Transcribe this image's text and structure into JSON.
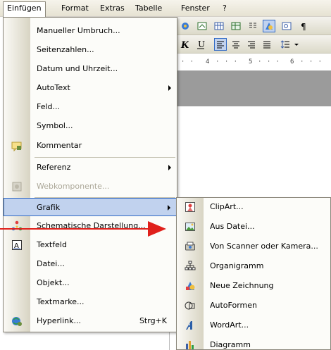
{
  "menubar": {
    "items": [
      {
        "label": "Einfügen",
        "active": true
      },
      {
        "label": "Format"
      },
      {
        "label": "Extras"
      },
      {
        "label": "Tabelle"
      },
      {
        "label": "Fenster"
      },
      {
        "label": "?"
      }
    ]
  },
  "ruler": {
    "marks": [
      "4",
      "5",
      "6"
    ]
  },
  "insert_menu": {
    "items": [
      {
        "label": "Manueller Umbruch..."
      },
      {
        "label": "Seitenzahlen..."
      },
      {
        "label": "Datum und Uhrzeit..."
      },
      {
        "label": "AutoText",
        "submenu": true
      },
      {
        "label": "Feld..."
      },
      {
        "label": "Symbol..."
      },
      {
        "label": "Kommentar",
        "icon": "comment-icon"
      },
      {
        "label": "Referenz",
        "submenu": true
      },
      {
        "label": "Webkomponente...",
        "icon": "web-component-icon",
        "disabled": true
      },
      {
        "label": "Grafik",
        "submenu": true,
        "highlighted": true
      },
      {
        "label": "Schematische Darstellung...",
        "icon": "diagram-icon"
      },
      {
        "label": "Textfeld",
        "icon": "textbox-icon"
      },
      {
        "label": "Datei..."
      },
      {
        "label": "Objekt..."
      },
      {
        "label": "Textmarke..."
      },
      {
        "label": "Hyperlink...",
        "icon": "hyperlink-icon",
        "shortcut": "Strg+K"
      }
    ]
  },
  "grafik_submenu": {
    "items": [
      {
        "label": "ClipArt...",
        "icon": "clipart-icon"
      },
      {
        "label": "Aus Datei...",
        "icon": "picture-file-icon"
      },
      {
        "label": "Von Scanner oder Kamera...",
        "icon": "scanner-icon"
      },
      {
        "label": "Organigramm",
        "icon": "org-chart-icon"
      },
      {
        "label": "Neue Zeichnung",
        "icon": "new-drawing-icon"
      },
      {
        "label": "AutoFormen",
        "icon": "autoshapes-icon"
      },
      {
        "label": "WordArt...",
        "icon": "wordart-icon"
      },
      {
        "label": "Diagramm",
        "icon": "chart-icon"
      }
    ]
  },
  "colors": {
    "highlight_bg": "#c1d2ee",
    "highlight_border": "#316ac5",
    "annotation_arrow": "#e0201b"
  }
}
